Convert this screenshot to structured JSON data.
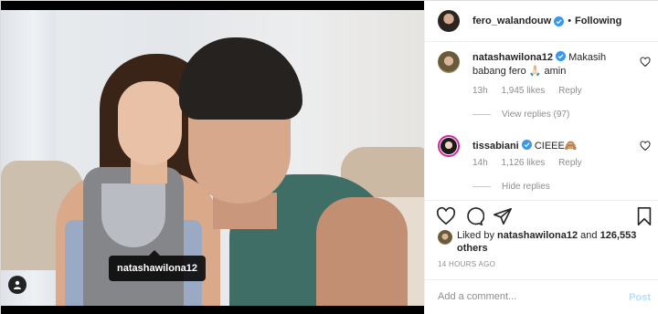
{
  "photo": {
    "tag_label": "natashawilona12"
  },
  "header": {
    "username": "fero_walandouw",
    "separator": "•",
    "follow_status": "Following"
  },
  "comments": [
    {
      "username": "natashawilona12",
      "text": "Makasih babang fero 🙏🏻 amin",
      "time": "13h",
      "likes": "1,945 likes",
      "reply_label": "Reply",
      "replies_label": "View replies (97)"
    },
    {
      "username": "tissabiani",
      "text": "CIEEE🙈",
      "time": "14h",
      "likes": "1,126 likes",
      "reply_label": "Reply",
      "replies_label": "Hide replies"
    }
  ],
  "likes": {
    "prefix": "Liked by",
    "user": "natashawilona12",
    "connector": "and",
    "others": "126,553 others"
  },
  "timestamp": "14 HOURS AGO",
  "comment_box": {
    "placeholder": "Add a comment...",
    "post_label": "Post"
  },
  "colors": {
    "verified_blue": "#3897f0",
    "post_disabled": "#b2dffc",
    "story_ring": "#d6249f"
  }
}
